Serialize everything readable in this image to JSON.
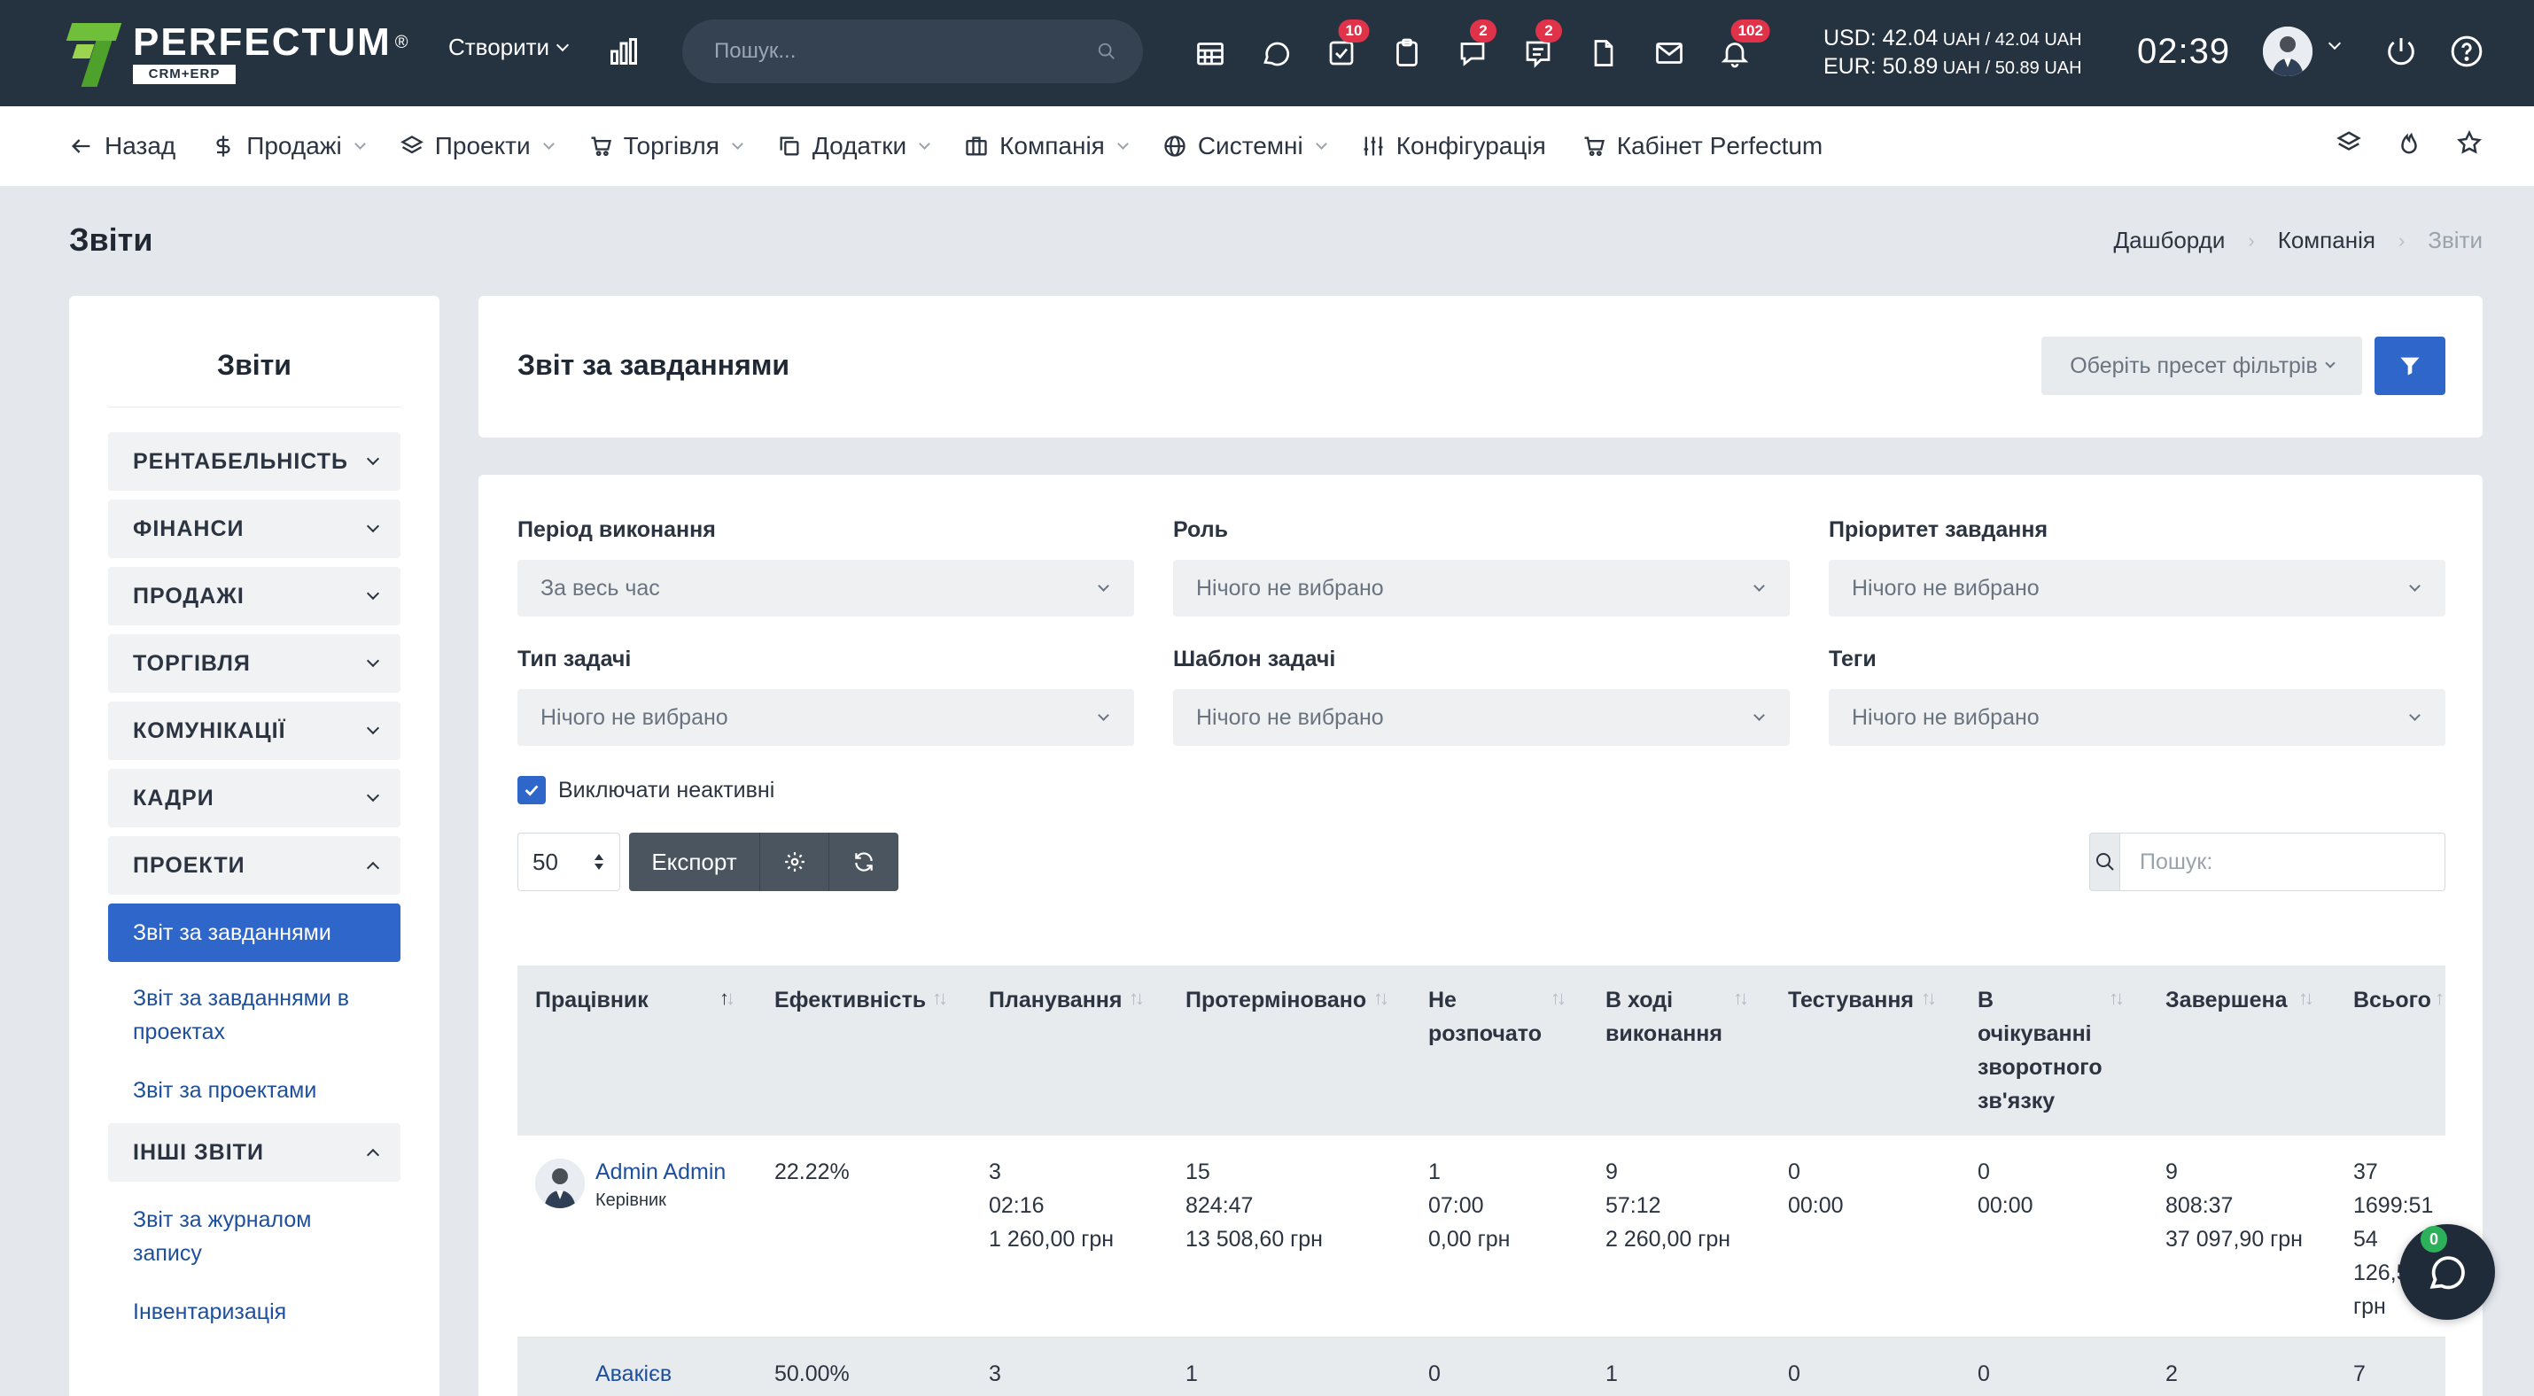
{
  "header": {
    "logo_word": "PERFECTUM",
    "logo_reg": "®",
    "logo_sub": "CRM+ERP",
    "create_label": "Створити",
    "search_placeholder": "Пошук...",
    "badges": {
      "tasks": "10",
      "chat": "2",
      "comments": "2",
      "bell": "102"
    },
    "usd_line": "USD: 42.04",
    "usd_mid": " UAH / 42.04 ",
    "usd_unit": "UAH",
    "eur_line": "EUR: 50.89",
    "eur_mid": " UAH / 50.89 ",
    "eur_unit": "UAH",
    "clock": "02:39"
  },
  "nav": {
    "back": "Назад",
    "sales": "Продажі",
    "projects": "Проекти",
    "trade": "Торгівля",
    "addons": "Додатки",
    "company": "Компанія",
    "system": "Системні",
    "config": "Конфігурація",
    "cabinet": "Кабінет Perfectum"
  },
  "page": {
    "title": "Звіти",
    "breadcrumb": [
      "Дашборди",
      "Компанія",
      "Звіти"
    ]
  },
  "sidebar": {
    "title": "Звіти",
    "groups": [
      "РЕНТАБЕЛЬНІСТЬ",
      "ФІНАНСИ",
      "ПРОДАЖІ",
      "ТОРГІВЛЯ",
      "КОМУНІКАЦІЇ",
      "КАДРИ",
      "ПРОЕКТИ"
    ],
    "project_links": [
      "Звіт за завданнями",
      "Звіт за завданнями в проектах",
      "Звіт за проектами"
    ],
    "other_group": "ІНШІ ЗВІТИ",
    "other_links": [
      "Звіт за журналом запису",
      "Інвентаризація"
    ]
  },
  "report": {
    "title": "Звіт за завданнями",
    "preset_placeholder": "Оберіть пресет фільтрів",
    "filters": {
      "period_label": "Період виконання",
      "period_value": "За весь час",
      "role_label": "Роль",
      "role_value": "Нічого не вибрано",
      "priority_label": "Пріоритет завдання",
      "priority_value": "Нічого не вибрано",
      "type_label": "Тип задачі",
      "type_value": "Нічого не вибрано",
      "template_label": "Шаблон задачі",
      "template_value": "Нічого не вибрано",
      "tags_label": "Теги",
      "tags_value": "Нічого не вибрано"
    },
    "exclude_inactive": "Виключати неактивні",
    "page_length": "50",
    "export_label": "Експорт",
    "table_search_placeholder": "Пошук:"
  },
  "table": {
    "columns": [
      "Працівник",
      "Ефективність",
      "Планування",
      "Протерміновано",
      "Не розпочато",
      "В ході виконання",
      "Тестування",
      "В очікуванні зворотного зв'язку",
      "Завершена",
      "Всього"
    ],
    "rows": [
      {
        "name": "Admin Admin",
        "role": "Керівник",
        "efficiency": "22.22%",
        "planning": [
          "3",
          "02:16",
          "1 260,00 грн"
        ],
        "overdue": [
          "15",
          "824:47",
          "13 508,60 грн"
        ],
        "not_started": [
          "1",
          "07:00",
          "0,00 грн"
        ],
        "in_progress": [
          "9",
          "57:12",
          "2 260,00 грн"
        ],
        "testing": [
          "0",
          "00:00"
        ],
        "awaiting": [
          "0",
          "00:00"
        ],
        "done": [
          "9",
          "808:37",
          "37 097,90 грн"
        ],
        "total": [
          "37",
          "1699:51",
          "54",
          "126,50",
          "грн"
        ]
      },
      {
        "name": "Авакієв",
        "efficiency": "50.00%",
        "planning": [
          "3"
        ],
        "overdue": [
          "1"
        ],
        "not_started": [
          "0"
        ],
        "in_progress": [
          "1"
        ],
        "testing": [
          "0"
        ],
        "awaiting": [
          "0"
        ],
        "done": [
          "2"
        ],
        "total": [
          "7"
        ]
      }
    ]
  },
  "chat": {
    "badge": "0"
  }
}
